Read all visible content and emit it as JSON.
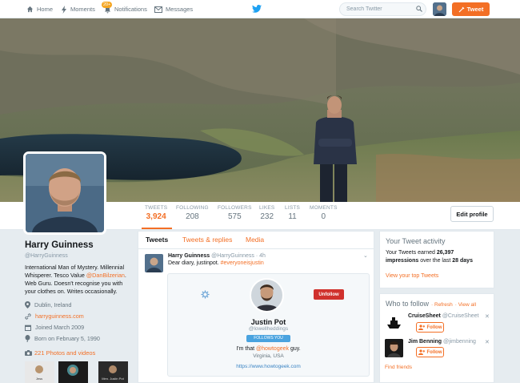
{
  "nav": {
    "home": "Home",
    "moments": "Moments",
    "notifications": "Notifications",
    "notifications_badge": "20+",
    "messages": "Messages",
    "search_placeholder": "Search Twitter",
    "tweet_button": "Tweet"
  },
  "stats": [
    {
      "label": "TWEETS",
      "value": "3,924"
    },
    {
      "label": "FOLLOWING",
      "value": "208"
    },
    {
      "label": "FOLLOWERS",
      "value": "575"
    },
    {
      "label": "LIKES",
      "value": "232"
    },
    {
      "label": "LISTS",
      "value": "11"
    },
    {
      "label": "MOMENTS",
      "value": "0"
    }
  ],
  "edit_profile": "Edit profile",
  "profile": {
    "name": "Harry Guinness",
    "handle": "@HarryGuinness",
    "bio_before": "International Man of Mystery. Millennial Whisperer. Tesco Value ",
    "bio_mention": "@DanBilzerian",
    "bio_after": ". Web Guru. Doesn't recognise you with your clothes on. Writes occasionally.",
    "location": "Dublin, Ireland",
    "website": "harryguinness.com",
    "joined": "Joined March 2009",
    "born": "Born on February 5, 1990",
    "photos": "221 Photos and videos",
    "thumbs": [
      "Jess",
      "",
      "",
      "Men. Justin Pot"
    ]
  },
  "tabs": [
    "Tweets",
    "Tweets & replies",
    "Media"
  ],
  "tweet": {
    "name": "Harry Guinness",
    "handle": "@HarryGuinness",
    "time": "· 4h",
    "text": "Dear diary, justinpot. ",
    "hashtag": "#everyoneisjustin",
    "card": {
      "unfollow": "Unfollow",
      "name": "Justin Pot",
      "handle": "@lowellheddings",
      "follows_you": "FOLLOWS YOU",
      "bio_before": "I'm that ",
      "bio_mention": "@howtogeek",
      "bio_after": " guy.",
      "location": "Virginia, USA",
      "url": "https://www.howtogeek.com"
    }
  },
  "activity": {
    "title": "Your Tweet activity",
    "text_before": "Your Tweets earned ",
    "impressions": "26,397 impressions",
    "text_mid": " over the last ",
    "days": "28 days",
    "link": "View your top Tweets"
  },
  "who_to_follow": {
    "title": "Who to follow",
    "refresh": "· Refresh",
    "view_all": "· View all",
    "users": [
      {
        "name": "CruiseSheet",
        "handle": "@CruiseSheet",
        "button": "Follow"
      },
      {
        "name": "Jim Benning",
        "handle": "@jimbenning",
        "button": "Follow"
      }
    ],
    "find_friends": "Find friends"
  },
  "colors": {
    "accent": "#f36f25",
    "twitter_blue": "#1da1f2"
  }
}
